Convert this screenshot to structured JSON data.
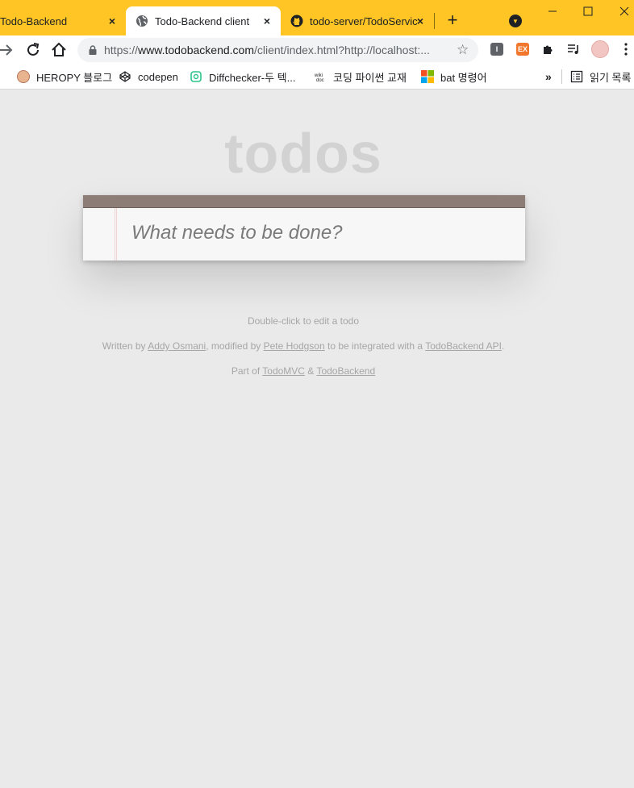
{
  "tabs": [
    {
      "title": "Todo-Backend",
      "close": "×"
    },
    {
      "title": "Todo-Backend client",
      "close": "×"
    },
    {
      "title": "todo-server/TodoServic",
      "close": "×"
    }
  ],
  "toolbar": {
    "url_scheme": "https://",
    "url_host": "www.todobackend.com",
    "url_path": "/client/index.html?http://localhost:..."
  },
  "bookmarks": [
    {
      "label": "HEROPY 블로그",
      "icon": "avatar-icon"
    },
    {
      "label": "codepen",
      "icon": "codepen-icon"
    },
    {
      "label": "Diffchecker-두 텍...",
      "icon": "diffchecker-icon"
    },
    {
      "label": "코딩 파이썬 교재",
      "icon": "wiki-icon"
    },
    {
      "label": "bat 명령어",
      "icon": "microsoft-icon"
    },
    {
      "label": "읽기 목록",
      "icon": "reading-list-icon"
    }
  ],
  "app": {
    "title": "todos",
    "input_placeholder": "What needs to be done?"
  },
  "info": {
    "line1": "Double-click to edit a todo",
    "written_by": "Written by ",
    "author1": "Addy Osmani",
    "modified_by": ", modified by ",
    "author2": "Pete Hodgson",
    "integrated": " to be integrated with a ",
    "api_link": "TodoBackend API",
    "period": ".",
    "part_of": "Part of ",
    "todomvc": "TodoMVC",
    "amp": " & ",
    "todobackend": "TodoBackend"
  },
  "colors": {
    "tabstrip": "#fec524",
    "page_bg": "#eaeaea",
    "header_bar": "#8d7d77"
  }
}
